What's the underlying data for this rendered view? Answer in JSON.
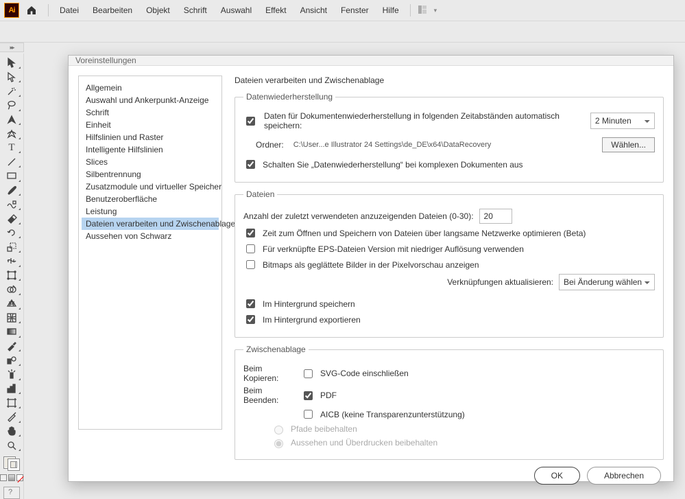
{
  "menubar": {
    "items": [
      "Datei",
      "Bearbeiten",
      "Objekt",
      "Schrift",
      "Auswahl",
      "Effekt",
      "Ansicht",
      "Fenster",
      "Hilfe"
    ]
  },
  "dialog": {
    "title": "Voreinstellungen",
    "categories": [
      "Allgemein",
      "Auswahl und Ankerpunkt-Anzeige",
      "Schrift",
      "Einheit",
      "Hilfslinien und Raster",
      "Intelligente Hilfslinien",
      "Slices",
      "Silbentrennung",
      "Zusatzmodule und virtueller Speicher",
      "Benutzeroberfläche",
      "Leistung",
      "Dateien verarbeiten und Zwischenablage",
      "Aussehen von Schwarz"
    ],
    "selected_index": 11,
    "content": {
      "heading": "Dateien verarbeiten und Zwischenablage",
      "recovery": {
        "legend": "Datenwiederherstellung",
        "auto_save_label": "Daten für Dokumentenwiederherstellung in folgenden Zeitabständen automatisch speichern:",
        "auto_save_checked": true,
        "interval_value": "2 Minuten",
        "folder_label": "Ordner:",
        "folder_path": "C:\\User...e Illustrator 24 Settings\\de_DE\\x64\\DataRecovery",
        "choose_label": "Wählen...",
        "disable_complex_label": "Schalten Sie „Datenwiederherstellung“ bei komplexen Dokumenten aus",
        "disable_complex_checked": true
      },
      "files": {
        "legend": "Dateien",
        "recent_label": "Anzahl der zuletzt verwendeten anzuzeigenden Dateien (0-30):",
        "recent_value": "20",
        "optimize_slow_label": "Zeit zum Öffnen und Speichern von Dateien über langsame Netzwerke optimieren (Beta)",
        "optimize_slow_checked": true,
        "eps_lowres_label": "Für verknüpfte EPS-Dateien Version mit niedriger Auflösung verwenden",
        "eps_lowres_checked": false,
        "bitmap_smooth_label": "Bitmaps als geglättete Bilder in der Pixelvorschau anzeigen",
        "bitmap_smooth_checked": false,
        "links_update_label": "Verknüpfungen aktualisieren:",
        "links_update_value": "Bei Änderung wählen",
        "bg_save_label": "Im Hintergrund speichern",
        "bg_save_checked": true,
        "bg_export_label": "Im Hintergrund exportieren",
        "bg_export_checked": true
      },
      "clipboard": {
        "legend": "Zwischenablage",
        "on_copy_label": "Beim Kopieren:",
        "svg_label": "SVG-Code einschließen",
        "svg_checked": false,
        "on_quit_label": "Beim Beenden:",
        "pdf_label": "PDF",
        "pdf_checked": true,
        "aicb_label": "AICB (keine Transparenzunterstützung)",
        "aicb_checked": false,
        "paths_label": "Pfade beibehalten",
        "appearance_label": "Aussehen und Überdrucken beibehalten"
      }
    },
    "footer": {
      "ok": "OK",
      "cancel": "Abbrechen"
    }
  }
}
